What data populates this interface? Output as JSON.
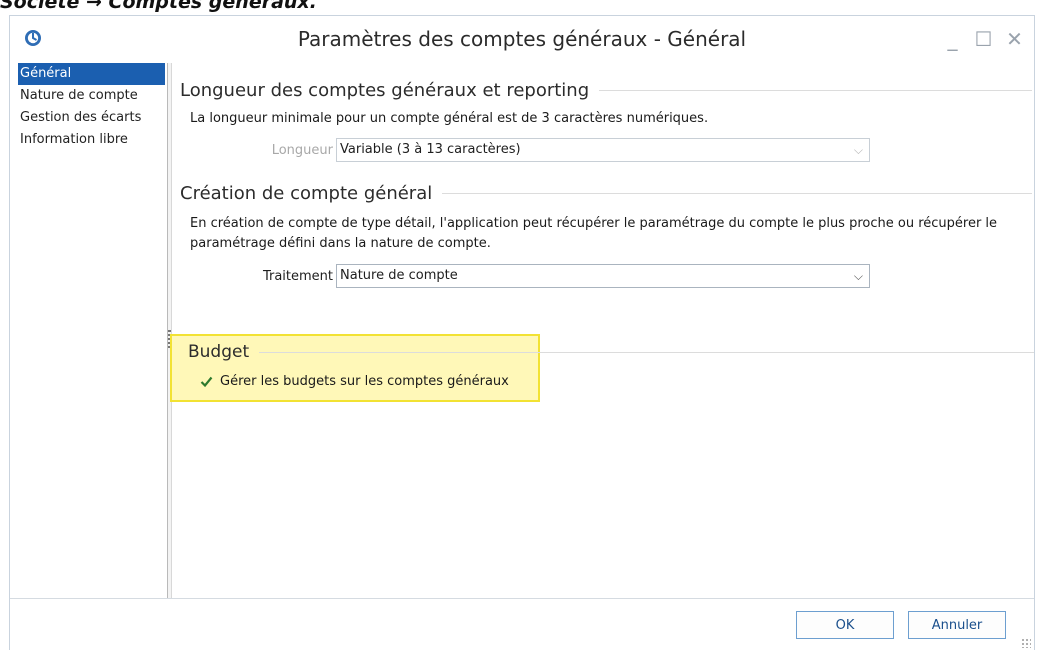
{
  "caption": "Société → Comptes généraux.",
  "window": {
    "title": "Paramètres des comptes généraux - Général",
    "minimize_glyph": "_",
    "maximize_glyph": "☐",
    "close_glyph": "✕"
  },
  "sidebar": {
    "items": [
      {
        "label": "Général",
        "active": true
      },
      {
        "label": "Nature de compte",
        "active": false
      },
      {
        "label": "Gestion des écarts",
        "active": false
      },
      {
        "label": "Information libre",
        "active": false
      }
    ]
  },
  "sections": {
    "longueur": {
      "title": "Longueur des comptes généraux et reporting",
      "description": "La longueur minimale pour un compte général est de 3 caractères numériques.",
      "field_label": "Longueur",
      "field_value": "Variable (3 à 13 caractères)"
    },
    "creation": {
      "title": "Création de compte général",
      "description": "En création de compte de type détail, l'application peut récupérer le paramétrage du compte le plus proche ou récupérer le paramétrage défini dans la nature de compte.",
      "field_label": "Traitement",
      "field_value": "Nature de compte"
    },
    "budget": {
      "title": "Budget",
      "checkbox_label": "Gérer les budgets sur les comptes généraux",
      "checked": true
    }
  },
  "footer": {
    "ok_label": "OK",
    "cancel_label": "Annuler"
  },
  "colors": {
    "accent": "#1b5fb0",
    "highlight": "#fff8b8",
    "highlight_border": "#f2e233",
    "check": "#2d7a2d"
  }
}
